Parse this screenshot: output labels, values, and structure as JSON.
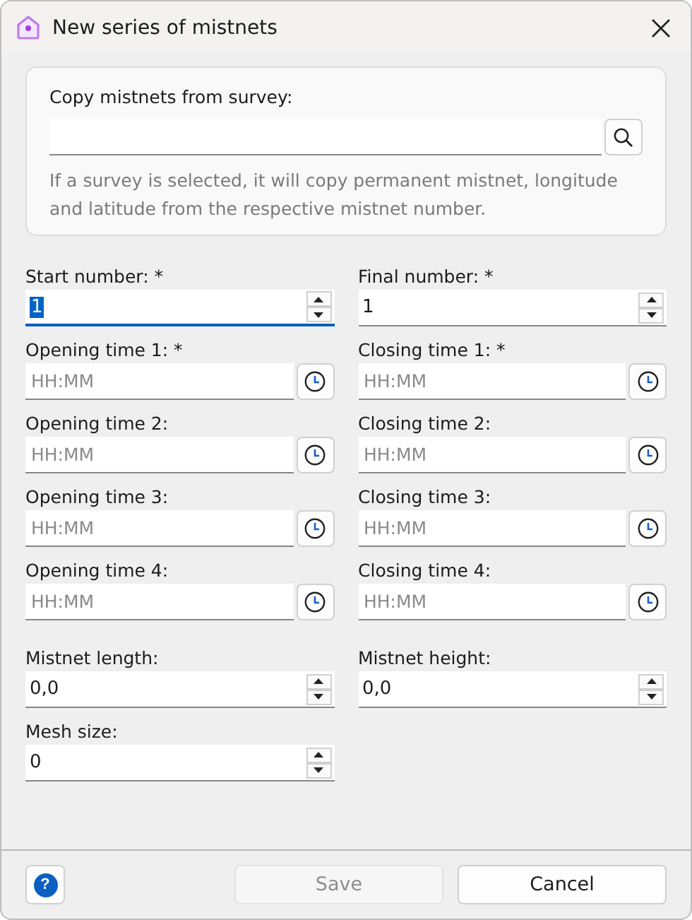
{
  "window": {
    "title": "New series of mistnets"
  },
  "copy_group": {
    "label": "Copy mistnets from survey:",
    "hint": "If a survey is selected, it will copy permanent mistnet, longitude and latitude from the respective mistnet number."
  },
  "fields": [
    {
      "label": "Start number: *",
      "kind": "spin",
      "value": "1",
      "focused": true
    },
    {
      "label": "Final number: *",
      "kind": "spin",
      "value": "1",
      "focused": false
    },
    {
      "label": "Opening time 1: *",
      "kind": "time",
      "placeholder": "HH:MM",
      "focused": false
    },
    {
      "label": "Closing time 1: *",
      "kind": "time",
      "placeholder": "HH:MM",
      "focused": false
    },
    {
      "label": "Opening time 2:",
      "kind": "time",
      "placeholder": "HH:MM",
      "focused": false
    },
    {
      "label": "Closing time 2:",
      "kind": "time",
      "placeholder": "HH:MM",
      "focused": false
    },
    {
      "label": "Opening time 3:",
      "kind": "time",
      "placeholder": "HH:MM",
      "focused": false
    },
    {
      "label": "Closing time 3:",
      "kind": "time",
      "placeholder": "HH:MM",
      "focused": false
    },
    {
      "label": "Opening time 4:",
      "kind": "time",
      "placeholder": "HH:MM",
      "focused": false
    },
    {
      "label": "Closing time 4:",
      "kind": "time",
      "placeholder": "HH:MM",
      "focused": false
    }
  ],
  "measures": [
    {
      "label": "Mistnet length:",
      "kind": "spin",
      "value": "0,0",
      "focused": false
    },
    {
      "label": "Mistnet height:",
      "kind": "spin",
      "value": "0,0",
      "focused": false
    },
    {
      "label": "Mesh size:",
      "kind": "spin",
      "value": "0",
      "focused": false
    }
  ],
  "footer": {
    "help": "?",
    "buttons": [
      {
        "label": "Save",
        "disabled": true
      },
      {
        "label": "Cancel",
        "disabled": false
      }
    ]
  }
}
